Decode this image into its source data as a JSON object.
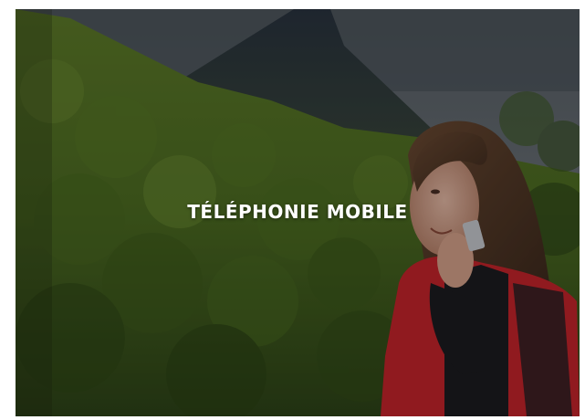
{
  "card": {
    "title": "TÉLÉPHONIE MOBILE",
    "image": "woman-on-mobile-phone-in-mountains-photo"
  },
  "colors": {
    "title_text": "#ffffff",
    "overlay": "#000000",
    "jacket_red": "#c8242b"
  }
}
